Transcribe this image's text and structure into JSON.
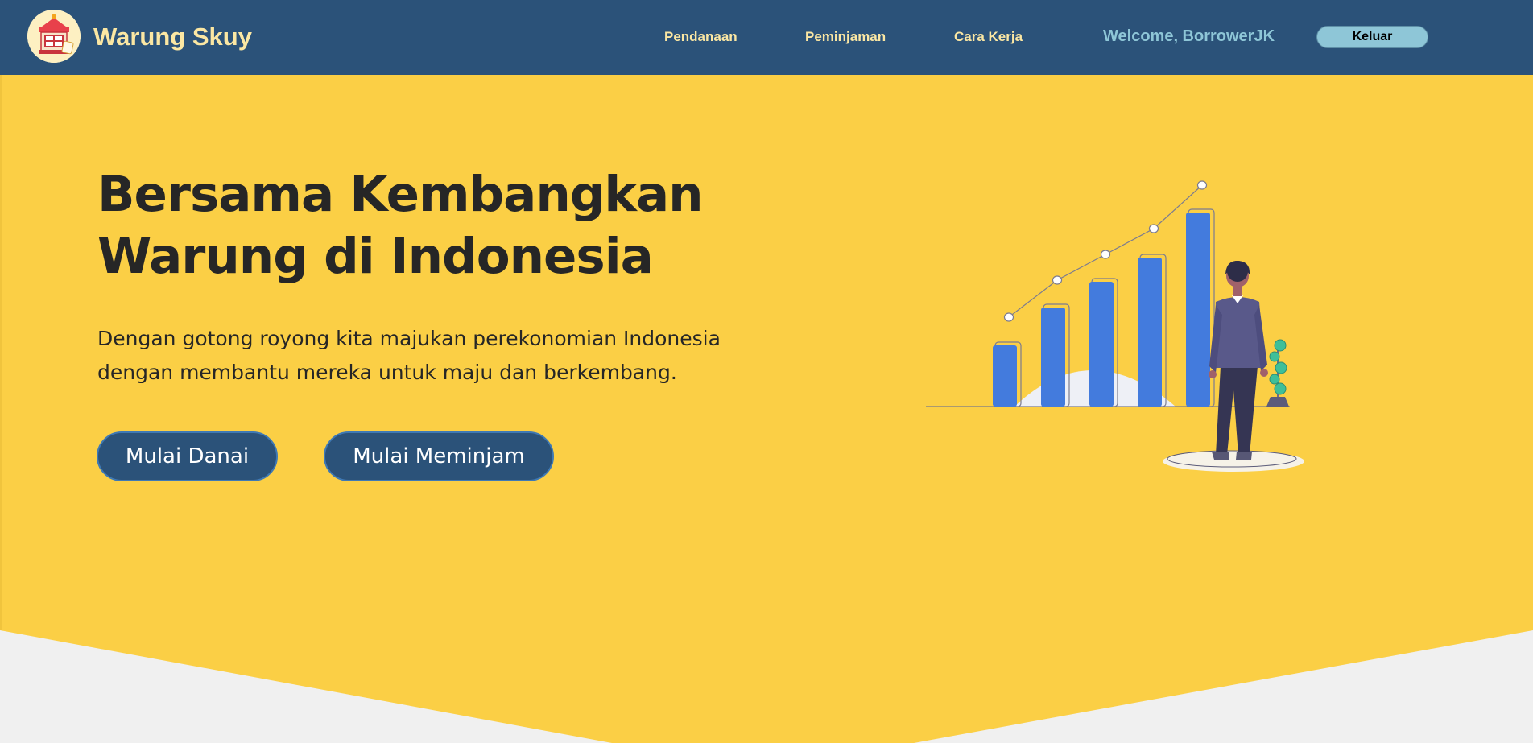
{
  "navbar": {
    "brand": "Warung Skuy",
    "links": [
      "Pendanaan",
      "Peminjaman",
      "Cara Kerja"
    ],
    "welcome": "Welcome, BorrowerJK",
    "logout_label": "Keluar"
  },
  "hero": {
    "title_line1": "Bersama Kembangkan",
    "title_line2": "Warung di Indonesia",
    "subtitle_line1": "Dengan gotong royong kita majukan perekonomian Indonesia",
    "subtitle_line2": "dengan membantu mereka untuk maju dan berkembang.",
    "cta_fund": "Mulai Danai",
    "cta_borrow": "Mulai Meminjam"
  },
  "colors": {
    "navbar": "#2b5279",
    "hero_yellow": "#fbcf45",
    "brand_text": "#fbe7a3",
    "accent_blue": "#8ec6d7",
    "bar_blue": "#437bdd"
  },
  "icons": {
    "logo": "warung-shop-icon"
  }
}
